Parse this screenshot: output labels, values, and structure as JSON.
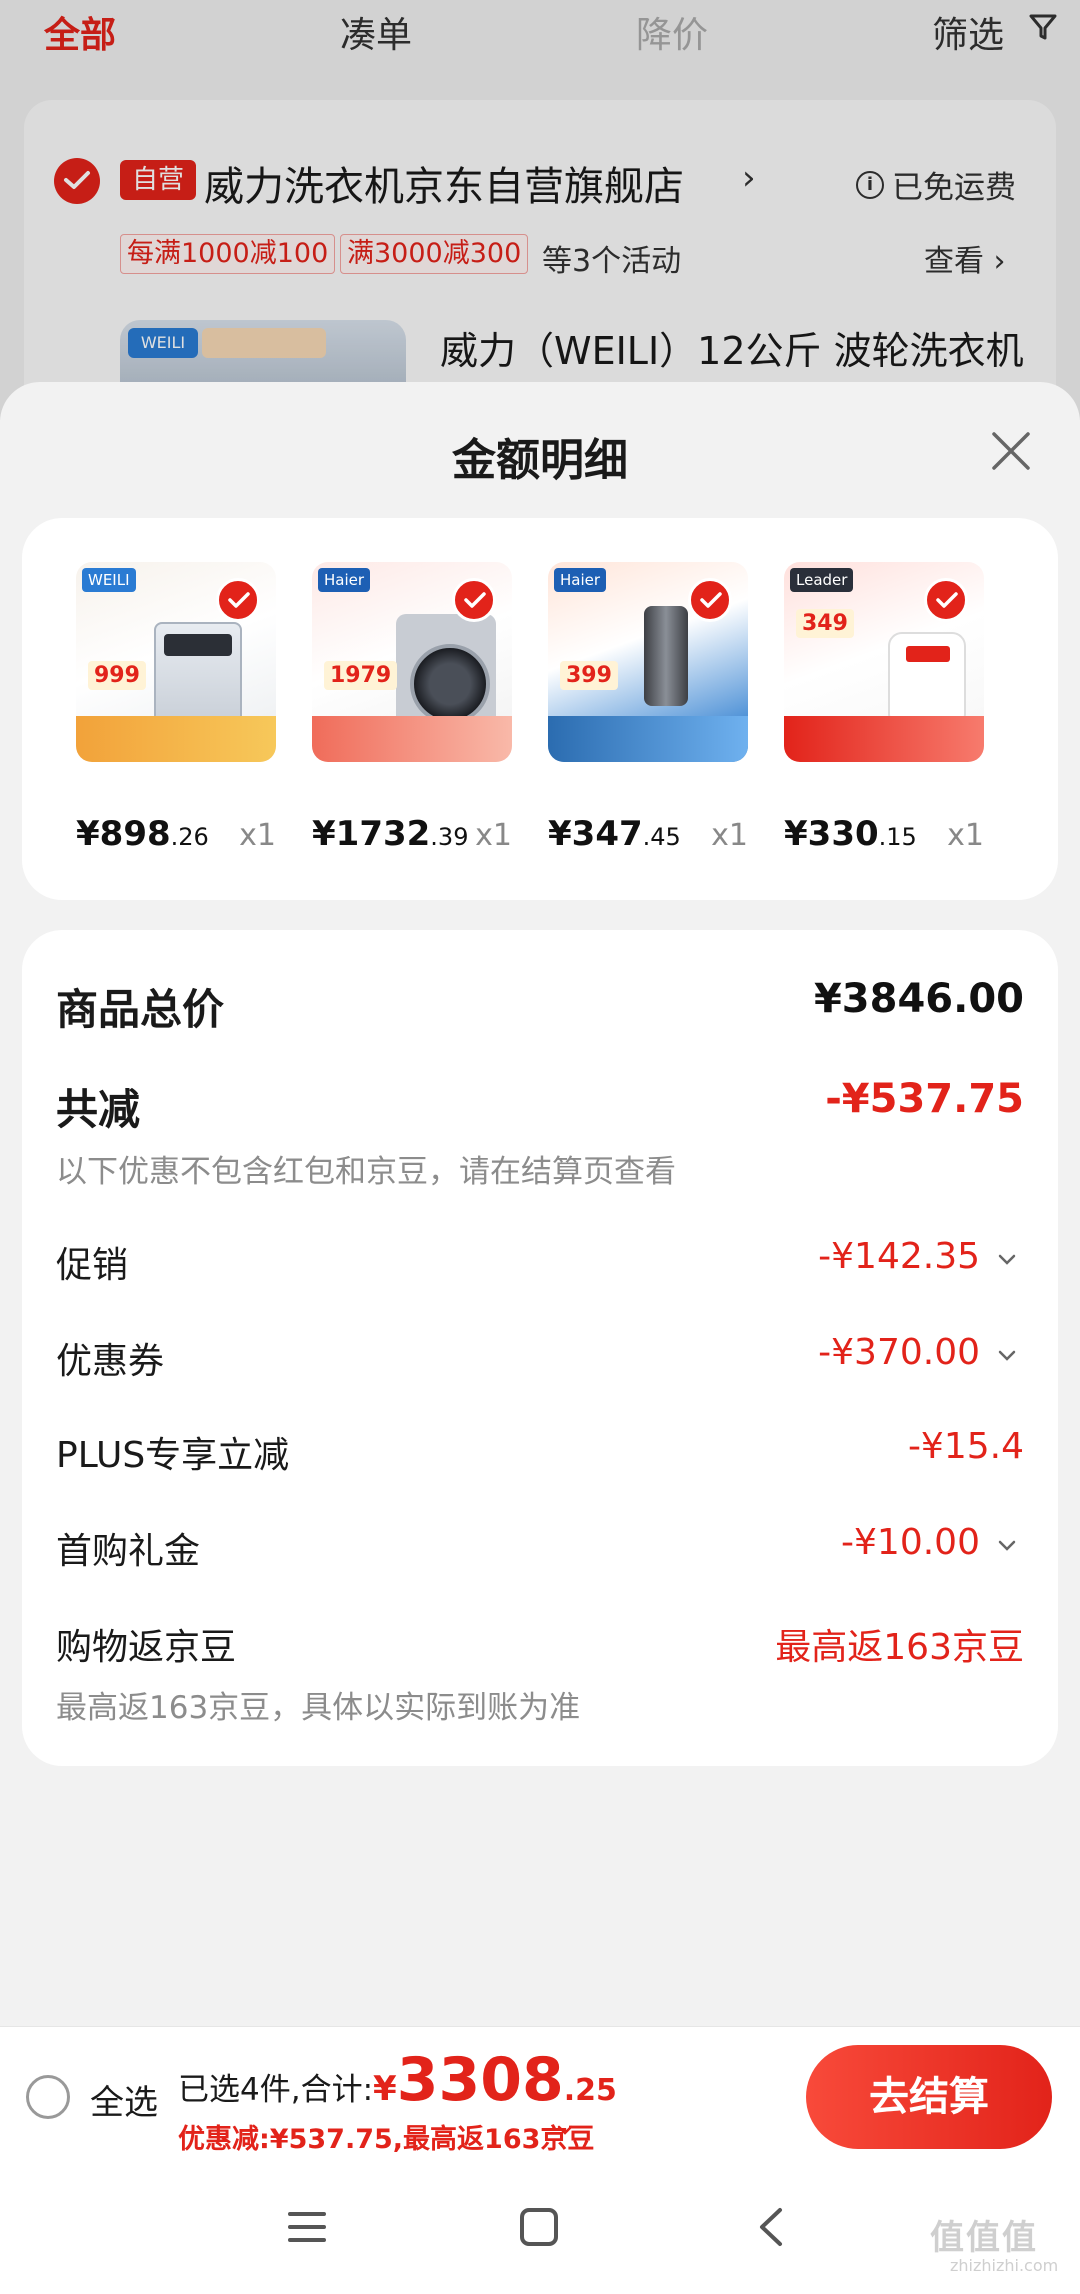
{
  "top_tabs": {
    "all": "全部",
    "combine": "凑单",
    "price_drop": "降价",
    "filter": "筛选"
  },
  "store": {
    "badge": "自营",
    "name": "威力洗衣机京东自营旗舰店",
    "shipping": "已免运费",
    "promos": [
      "每满1000减100",
      "满3000减300"
    ],
    "promo_more": "等3个活动",
    "view": "查看 ›",
    "product_title": "威力（WEILI）12公斤 波轮洗衣机"
  },
  "sheet": {
    "title": "金额明细",
    "items": [
      {
        "price_int": "¥898",
        "price_dec": ".26",
        "qty": "x1",
        "brand": "WEILI",
        "tag": "999"
      },
      {
        "price_int": "¥1732",
        "price_dec": ".39",
        "qty": "x1",
        "brand": "Haier",
        "tag": "1979"
      },
      {
        "price_int": "¥347",
        "price_dec": ".45",
        "qty": "x1",
        "brand": "Haier",
        "tag": "399"
      },
      {
        "price_int": "¥330",
        "price_dec": ".15",
        "qty": "x1",
        "brand": "Leader",
        "tag": "349"
      }
    ]
  },
  "summary": {
    "goods_total_label": "商品总价",
    "goods_total_value": "¥3846.00",
    "total_reduce_label": "共减",
    "total_reduce_value": "-¥537.75",
    "reduce_note": "以下优惠不包含红包和京豆，请在结算页查看",
    "promo_label": "促销",
    "promo_value": "-¥142.35",
    "coupon_label": "优惠券",
    "coupon_value": "-¥370.00",
    "plus_label": "PLUS专享立减",
    "plus_value": "-¥15.4",
    "first_gift_label": "首购礼金",
    "first_gift_value": "-¥10.00",
    "beans_label": "购物返京豆",
    "beans_value": "最高返163京豆",
    "beans_note": "最高返163京豆，具体以实际到账为准"
  },
  "bottom_bar": {
    "select_all": "全选",
    "selected_text": "已选4件,合计:",
    "currency": "¥",
    "total_int": "3308",
    "total_dec": ".25",
    "discount_text": "优惠减:¥537.75,最高返163京豆",
    "checkout": "去结算"
  },
  "watermark": {
    "main": "值值值",
    "sub": "zhizhizhi.com"
  },
  "colors": {
    "accent": "#e2231a",
    "text": "#1a1a1a",
    "muted": "#8c8c8c"
  }
}
